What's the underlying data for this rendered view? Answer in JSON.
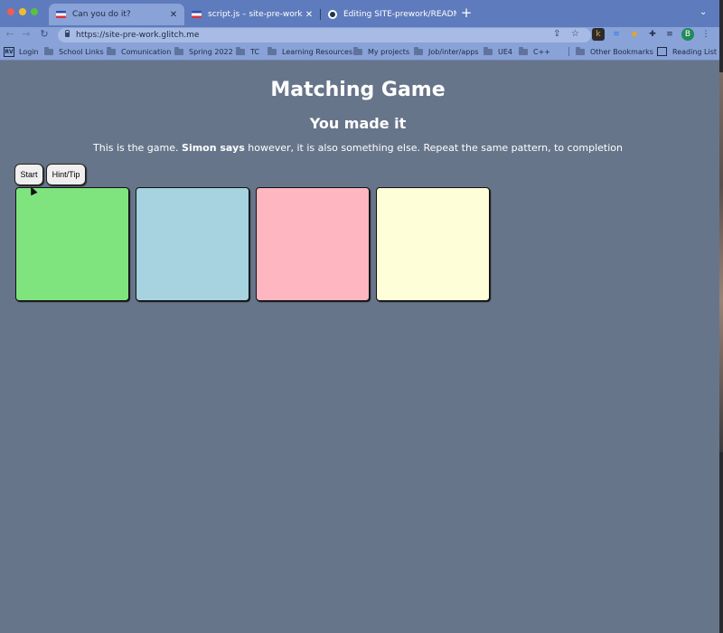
{
  "browser": {
    "tabs": [
      {
        "title": "Can you do it?",
        "active": true
      },
      {
        "title": "script.js – site-pre-work",
        "active": false
      },
      {
        "title": "Editing SITE-prework/README",
        "active": false
      }
    ],
    "url": "https://site-pre-work.glitch.me",
    "profile_initial": "B",
    "ext_k": "k",
    "bookmarks": [
      {
        "label": "Login",
        "icon": "gv-logo-icon"
      },
      {
        "label": "School Links",
        "icon": "folder-icon"
      },
      {
        "label": "Comunication",
        "icon": "folder-icon"
      },
      {
        "label": "Spring 2022",
        "icon": "folder-icon"
      },
      {
        "label": "TC",
        "icon": "folder-icon"
      },
      {
        "label": "Learning Resources",
        "icon": "folder-icon"
      },
      {
        "label": "My projects",
        "icon": "folder-icon"
      },
      {
        "label": "Job/inter/apps",
        "icon": "folder-icon"
      },
      {
        "label": "UE4",
        "icon": "folder-icon"
      },
      {
        "label": "C++",
        "icon": "folder-icon"
      }
    ],
    "other_bookmarks": "Other Bookmarks",
    "reading_list": "Reading List"
  },
  "page": {
    "title": "Matching Game",
    "subtitle": "You made it",
    "description_pre": "This is the game. ",
    "description_bold": "Simon says",
    "description_post": " however, it is also something else. Repeat the same pattern, to completion",
    "start_label": "Start",
    "hint_label": "Hint/Tip",
    "pads": [
      {
        "color": "#7fe47e"
      },
      {
        "color": "#a6d3df"
      },
      {
        "color": "#feb6c1"
      },
      {
        "color": "#fefed8"
      }
    ]
  }
}
